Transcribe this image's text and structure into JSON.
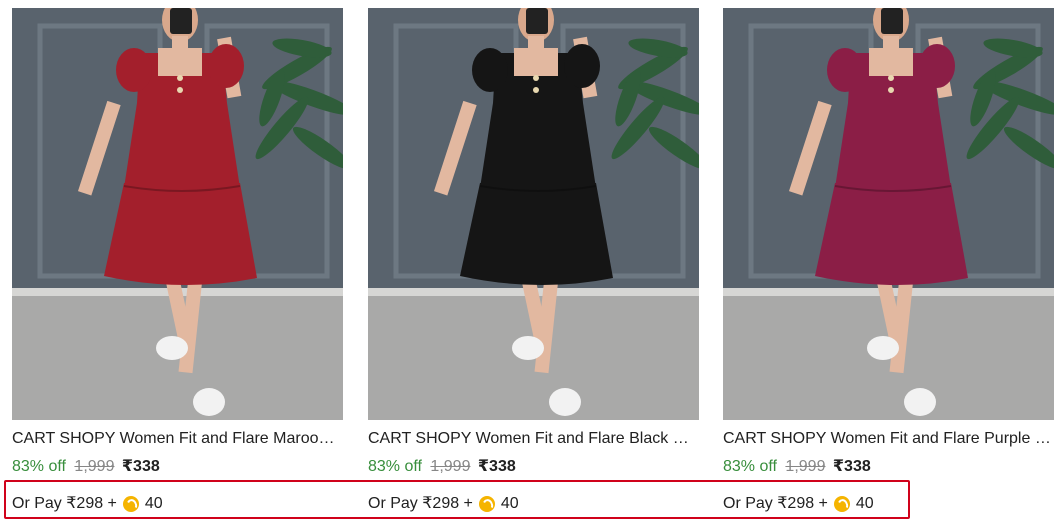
{
  "products": [
    {
      "title": "CART SHOPY Women Fit and Flare Maroon Dress",
      "discount": "83% off",
      "mrp": "1,999",
      "price": "₹338",
      "pay_text": "Or Pay ₹298 +",
      "coins": "40",
      "dress_color": "#a31f2c",
      "image_icon": "dress-photo"
    },
    {
      "title": "CART SHOPY Women Fit and Flare Black Dress",
      "discount": "83% off",
      "mrp": "1,999",
      "price": "₹338",
      "pay_text": "Or Pay ₹298 +",
      "coins": "40",
      "dress_color": "#151515",
      "image_icon": "dress-photo"
    },
    {
      "title": "CART SHOPY Women Fit and Flare Purple Dress",
      "discount": "83% off",
      "mrp": "1,999",
      "price": "₹338",
      "pay_text": "Or Pay ₹298 +",
      "coins": "40",
      "dress_color": "#8b1e46",
      "image_icon": "dress-photo"
    }
  ],
  "colors": {
    "discount_green": "#388e3c",
    "highlight_red": "#d0021b",
    "coin_gold": "#f5b400"
  }
}
